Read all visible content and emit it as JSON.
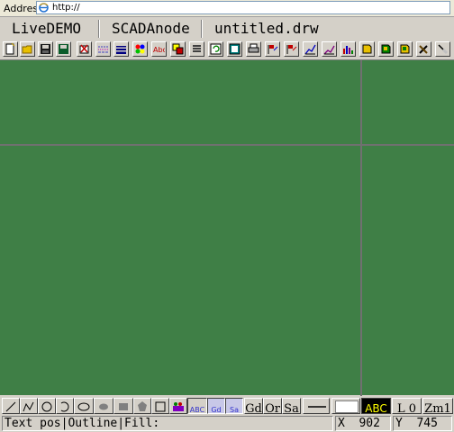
{
  "browser": {
    "address_label": "Address",
    "url": "http://"
  },
  "title": {
    "app": "LiveDEMO",
    "product": "SCADAnode",
    "filename": "untitled.drw"
  },
  "toolbar": {
    "icons": [
      "new-file-icon",
      "open-folder-icon",
      "save-icon",
      "save-as-icon",
      "cut-icon",
      "line-style-icon",
      "line-width-icon",
      "color-palette-icon",
      "text-abc-icon",
      "fill-icon",
      "layers-icon",
      "refresh-icon",
      "grid-icon",
      "print-icon",
      "tag-flag-icon",
      "tag-flag-2-icon",
      "trend-icon",
      "trend-2-icon",
      "bar-chart-icon",
      "object-icon",
      "object-2-icon",
      "object-3-icon",
      "tools-icon",
      "help-icon"
    ]
  },
  "tools": {
    "text_abc": "ABC",
    "text_gd": "Gd",
    "text_sa": "Sa",
    "btn_gd": "Gd",
    "btn_or": "Or",
    "btn_sa": "Sa",
    "font_sample": "ABC",
    "layer": "L 0",
    "zoom": "Zm1"
  },
  "status": {
    "mode": "Text pos|Outline|Fill:",
    "x_label": "X",
    "x_value": "902",
    "y_label": "Y",
    "y_value": "745"
  },
  "colors": {
    "canvas": "#3f7f46",
    "grid": "#707070",
    "font_sample_bg": "#000000",
    "font_sample_fg": "#ffff00",
    "fill_swatch": "#ffffff"
  }
}
